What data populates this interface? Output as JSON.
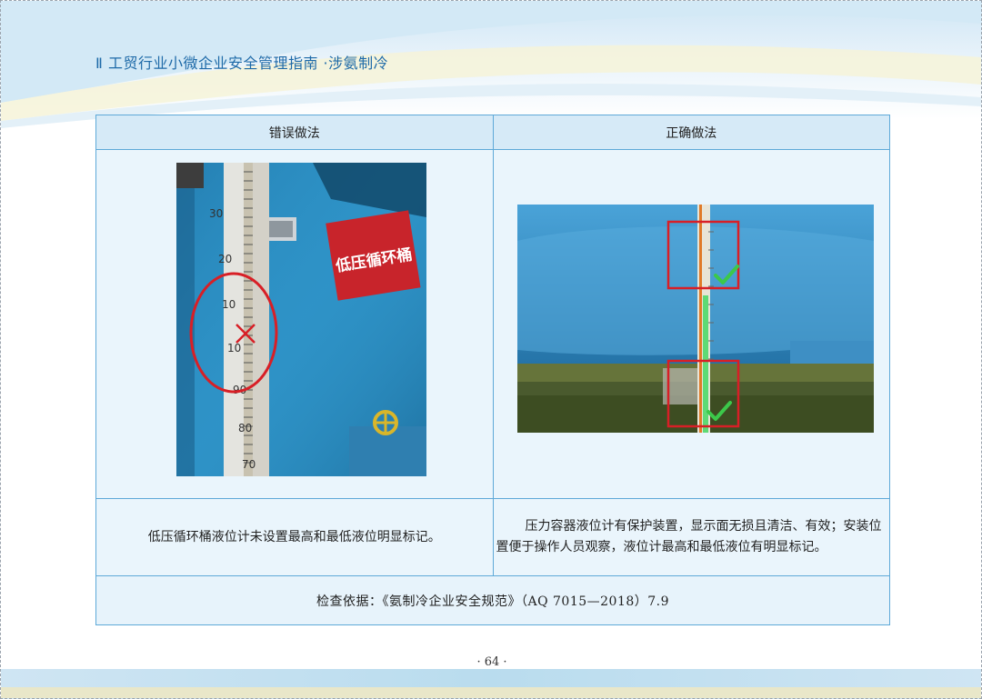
{
  "header": {
    "title": "Ⅱ 工贸行业小微企业安全管理指南 ·涉氨制冷"
  },
  "table": {
    "wrong_header": "错误做法",
    "right_header": "正确做法",
    "wrong_description": "低压循环桶液位计未设置最高和最低液位明显标记。",
    "right_description_line1": "压力容器液位计有保护装置，显示面无损且清洁、有效；",
    "right_description_rest": "安装位置便于操作人员观察，液位计最高和最低液位有明显标记。",
    "basis": "检查依据：《氨制冷企业安全规范》（AQ 7015—2018）7.9"
  },
  "photos": {
    "wrong": {
      "sign_text": "低压循环桶",
      "scale_labels": [
        "30",
        "20",
        "10",
        "10",
        "90",
        "80",
        "70"
      ],
      "mark_icon": "red-cross-icon"
    },
    "right": {
      "mark_icon": "green-check-icon"
    }
  },
  "footer": {
    "page_number": "· 64 ·"
  },
  "colors": {
    "header_text": "#1e6aa8",
    "table_border": "#5ea9d8",
    "table_bg": "#eaf5fc",
    "mark_red": "#d81f26",
    "mark_green": "#3cc84a"
  }
}
